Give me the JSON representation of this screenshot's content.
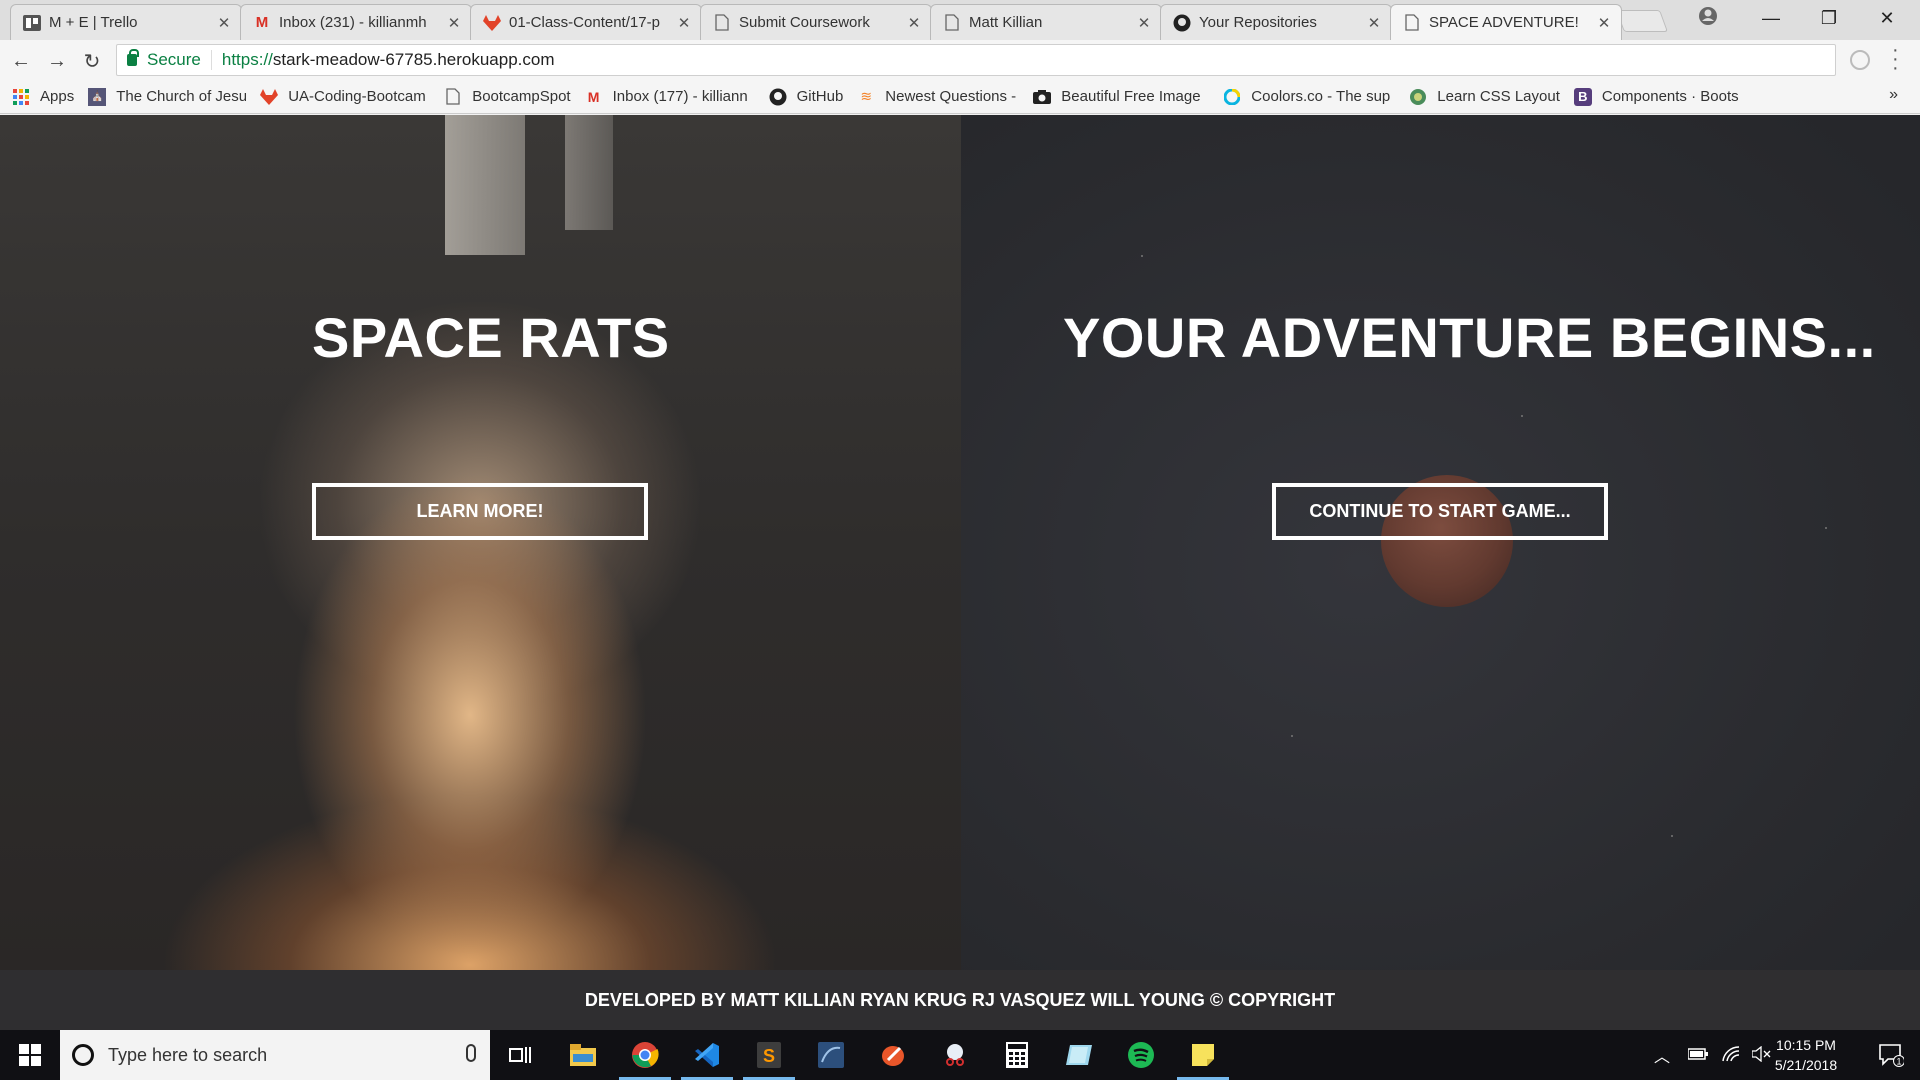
{
  "browser": {
    "tabs": [
      {
        "title": "M + E | Trello",
        "icon": "trello-icon"
      },
      {
        "title": "Inbox (231) - killianmh",
        "icon": "gmail-icon"
      },
      {
        "title": "01-Class-Content/17-p",
        "icon": "gitlab-icon"
      },
      {
        "title": "Submit Coursework",
        "icon": "page-icon"
      },
      {
        "title": "Matt Killian",
        "icon": "page-icon"
      },
      {
        "title": "Your Repositories",
        "icon": "github-icon"
      },
      {
        "title": "SPACE ADVENTURE!",
        "icon": "page-icon"
      }
    ],
    "address": {
      "secure_label": "Secure",
      "scheme": "https://",
      "host": "stark-meadow-67785.herokuapp.com"
    },
    "bookmarks": [
      {
        "label": "Apps",
        "icon": "apps-grid-icon"
      },
      {
        "label": "The Church of Jesus",
        "icon": "church-icon"
      },
      {
        "label": "UA-Coding-Bootcam",
        "icon": "gitlab-icon"
      },
      {
        "label": "BootcampSpot",
        "icon": "page-icon"
      },
      {
        "label": "Inbox (177) - killiann",
        "icon": "gmail-icon"
      },
      {
        "label": "GitHub",
        "icon": "github-icon"
      },
      {
        "label": "Newest Questions -",
        "icon": "stackoverflow-icon"
      },
      {
        "label": "Beautiful Free Image",
        "icon": "camera-icon"
      },
      {
        "label": "Coolors.co - The sup",
        "icon": "coolors-icon"
      },
      {
        "label": "Learn CSS Layout",
        "icon": "globe-icon"
      },
      {
        "label": "Components · Boots",
        "icon": "bootstrap-icon"
      }
    ],
    "more_label": "»"
  },
  "page": {
    "left": {
      "title": "SPACE RATS",
      "button": "LEARN MORE!"
    },
    "right": {
      "title": "YOUR ADVENTURE BEGINS...",
      "button": "CONTINUE TO START GAME..."
    },
    "footer": "DEVELOPED BY MATT KILLIAN RYAN KRUG RJ VASQUEZ WILL YOUNG © COPYRIGHT"
  },
  "taskbar": {
    "search_placeholder": "Type here to search",
    "apps": [
      "task-view-icon",
      "file-explorer-icon",
      "chrome-icon",
      "vscode-icon",
      "sublime-icon",
      "mysql-workbench-icon",
      "paint-icon",
      "snipping-icon",
      "calculator-icon",
      "onenote-icon",
      "spotify-icon",
      "sticky-notes-icon"
    ],
    "time": "10:15 PM",
    "date": "5/21/2018",
    "notification_count": "1"
  },
  "colors": {
    "secure_green": "#0b8043",
    "footer_bg": "#2f2e30",
    "taskbar_bg": "#101014",
    "accent_blue": "#76b9ed"
  }
}
